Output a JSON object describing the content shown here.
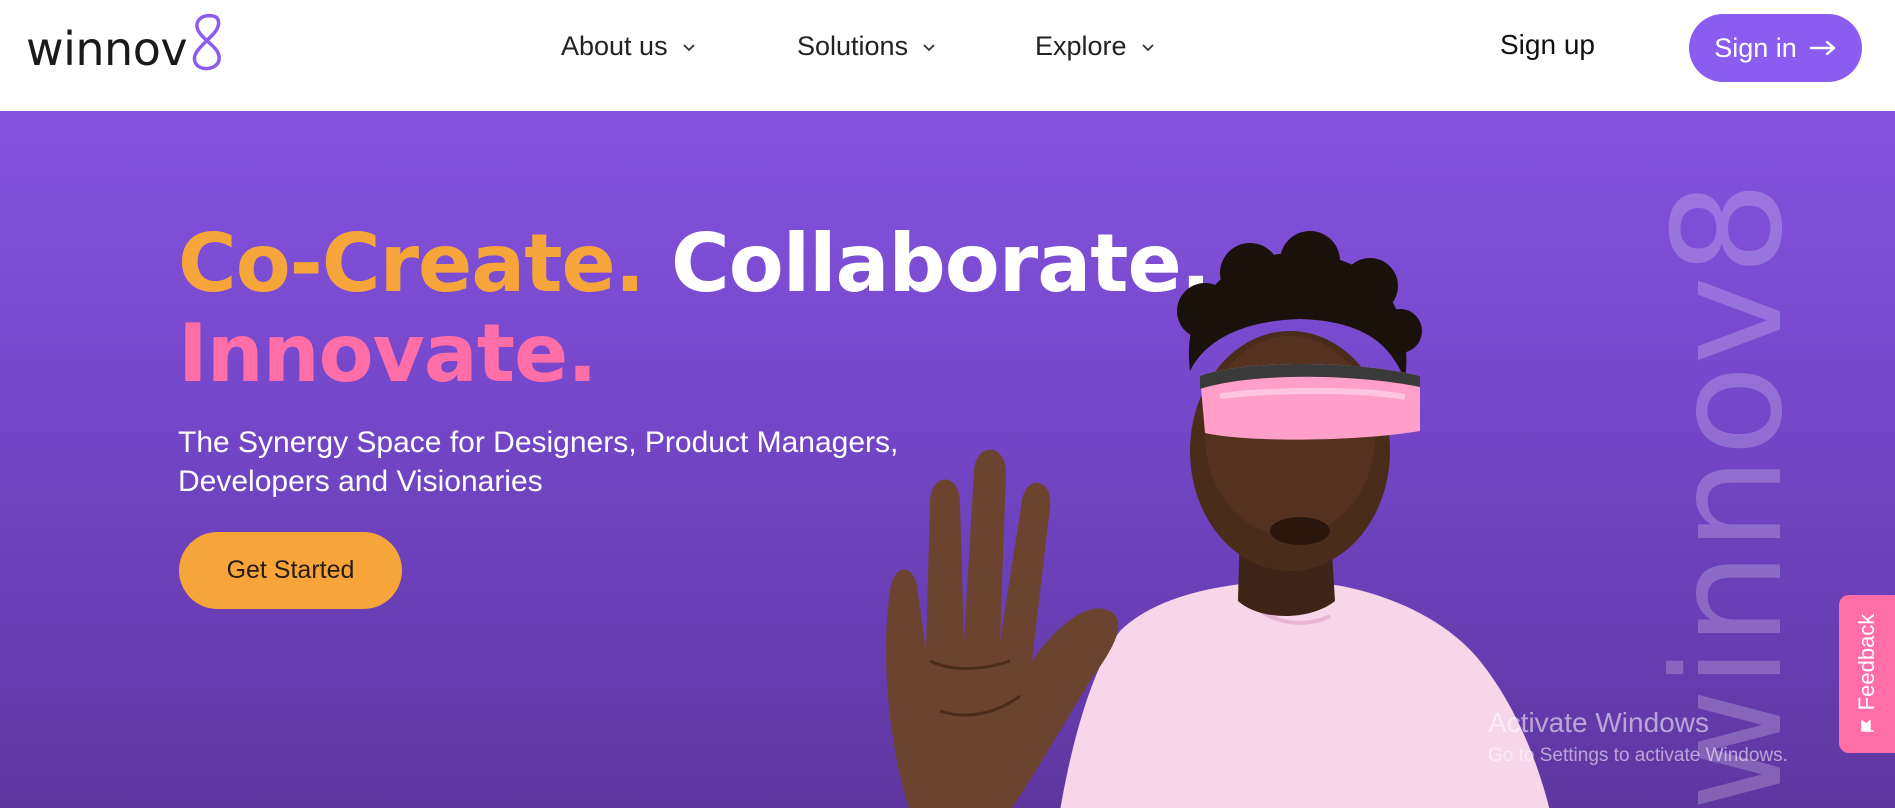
{
  "header": {
    "logo_text": "winnov",
    "nav": [
      {
        "label": "About us"
      },
      {
        "label": "Solutions"
      },
      {
        "label": "Explore"
      }
    ],
    "signup_label": "Sign up",
    "signin_label": "Sign in"
  },
  "hero": {
    "headline_part1": "Co-Create.",
    "headline_part2": "Collaborate.",
    "headline_part3": "Innovate.",
    "subtitle_line1": "The Synergy Space for Designers, Product Managers,",
    "subtitle_line2": "Developers and Visionaries",
    "cta_label": "Get Started",
    "brand_vertical": "winnov8"
  },
  "feedback_label": "Feedback",
  "windows_notice": {
    "title": "Activate Windows",
    "subtitle": "Go to Settings to activate Windows."
  },
  "colors": {
    "accent_purple": "#8b5cf0",
    "accent_orange": "#f6a53b",
    "accent_pink": "#ff6ea6"
  },
  "icons": [
    "chevron-down-icon",
    "arrow-right-icon",
    "flag-icon"
  ]
}
